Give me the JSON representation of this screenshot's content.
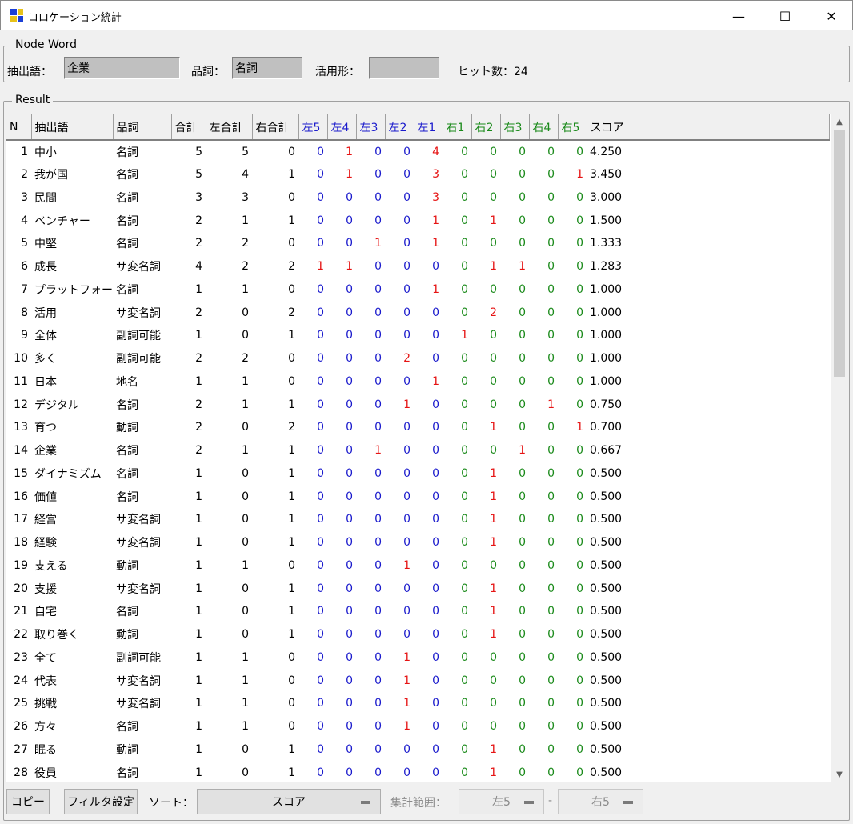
{
  "window": {
    "title": "コロケーション統計",
    "minimize_label": "—",
    "maximize_label": "☐",
    "close_label": "✕"
  },
  "node_word": {
    "legend": "Node Word",
    "extract_label": "抽出語：",
    "extract_value": "企業",
    "pos_label": "品詞：",
    "pos_value": "名詞",
    "conj_label": "活用形：",
    "conj_value": "",
    "hits_label": "ヒット数：24"
  },
  "result": {
    "legend": "Result",
    "columns": [
      "N",
      "抽出語",
      "品詞",
      "合計",
      "左合計",
      "右合計",
      "左5",
      "左4",
      "左3",
      "左2",
      "左1",
      "右1",
      "右2",
      "右3",
      "右4",
      "右5",
      "スコア"
    ],
    "rows": [
      [
        "1",
        "中小",
        "名詞",
        "5",
        "5",
        "0",
        "0",
        "1",
        "0",
        "0",
        "4",
        "0",
        "0",
        "0",
        "0",
        "0",
        "4.250"
      ],
      [
        "2",
        "我が国",
        "名詞",
        "5",
        "4",
        "1",
        "0",
        "1",
        "0",
        "0",
        "3",
        "0",
        "0",
        "0",
        "0",
        "1",
        "3.450"
      ],
      [
        "3",
        "民間",
        "名詞",
        "3",
        "3",
        "0",
        "0",
        "0",
        "0",
        "0",
        "3",
        "0",
        "0",
        "0",
        "0",
        "0",
        "3.000"
      ],
      [
        "4",
        "ベンチャー",
        "名詞",
        "2",
        "1",
        "1",
        "0",
        "0",
        "0",
        "0",
        "1",
        "0",
        "1",
        "0",
        "0",
        "0",
        "1.500"
      ],
      [
        "5",
        "中堅",
        "名詞",
        "2",
        "2",
        "0",
        "0",
        "0",
        "1",
        "0",
        "1",
        "0",
        "0",
        "0",
        "0",
        "0",
        "1.333"
      ],
      [
        "6",
        "成長",
        "サ変名詞",
        "4",
        "2",
        "2",
        "1",
        "1",
        "0",
        "0",
        "0",
        "0",
        "1",
        "1",
        "0",
        "0",
        "1.283"
      ],
      [
        "7",
        "プラットフォーム",
        "名詞",
        "1",
        "1",
        "0",
        "0",
        "0",
        "0",
        "0",
        "1",
        "0",
        "0",
        "0",
        "0",
        "0",
        "1.000"
      ],
      [
        "8",
        "活用",
        "サ変名詞",
        "2",
        "0",
        "2",
        "0",
        "0",
        "0",
        "0",
        "0",
        "0",
        "2",
        "0",
        "0",
        "0",
        "1.000"
      ],
      [
        "9",
        "全体",
        "副詞可能",
        "1",
        "0",
        "1",
        "0",
        "0",
        "0",
        "0",
        "0",
        "1",
        "0",
        "0",
        "0",
        "0",
        "1.000"
      ],
      [
        "10",
        "多く",
        "副詞可能",
        "2",
        "2",
        "0",
        "0",
        "0",
        "0",
        "2",
        "0",
        "0",
        "0",
        "0",
        "0",
        "0",
        "1.000"
      ],
      [
        "11",
        "日本",
        "地名",
        "1",
        "1",
        "0",
        "0",
        "0",
        "0",
        "0",
        "1",
        "0",
        "0",
        "0",
        "0",
        "0",
        "1.000"
      ],
      [
        "12",
        "デジタル",
        "名詞",
        "2",
        "1",
        "1",
        "0",
        "0",
        "0",
        "1",
        "0",
        "0",
        "0",
        "0",
        "1",
        "0",
        "0.750"
      ],
      [
        "13",
        "育つ",
        "動詞",
        "2",
        "0",
        "2",
        "0",
        "0",
        "0",
        "0",
        "0",
        "0",
        "1",
        "0",
        "0",
        "1",
        "0.700"
      ],
      [
        "14",
        "企業",
        "名詞",
        "2",
        "1",
        "1",
        "0",
        "0",
        "1",
        "0",
        "0",
        "0",
        "0",
        "1",
        "0",
        "0",
        "0.667"
      ],
      [
        "15",
        "ダイナミズム",
        "名詞",
        "1",
        "0",
        "1",
        "0",
        "0",
        "0",
        "0",
        "0",
        "0",
        "1",
        "0",
        "0",
        "0",
        "0.500"
      ],
      [
        "16",
        "価値",
        "名詞",
        "1",
        "0",
        "1",
        "0",
        "0",
        "0",
        "0",
        "0",
        "0",
        "1",
        "0",
        "0",
        "0",
        "0.500"
      ],
      [
        "17",
        "経営",
        "サ変名詞",
        "1",
        "0",
        "1",
        "0",
        "0",
        "0",
        "0",
        "0",
        "0",
        "1",
        "0",
        "0",
        "0",
        "0.500"
      ],
      [
        "18",
        "経験",
        "サ変名詞",
        "1",
        "0",
        "1",
        "0",
        "0",
        "0",
        "0",
        "0",
        "0",
        "1",
        "0",
        "0",
        "0",
        "0.500"
      ],
      [
        "19",
        "支える",
        "動詞",
        "1",
        "1",
        "0",
        "0",
        "0",
        "0",
        "1",
        "0",
        "0",
        "0",
        "0",
        "0",
        "0",
        "0.500"
      ],
      [
        "20",
        "支援",
        "サ変名詞",
        "1",
        "0",
        "1",
        "0",
        "0",
        "0",
        "0",
        "0",
        "0",
        "1",
        "0",
        "0",
        "0",
        "0.500"
      ],
      [
        "21",
        "自宅",
        "名詞",
        "1",
        "0",
        "1",
        "0",
        "0",
        "0",
        "0",
        "0",
        "0",
        "1",
        "0",
        "0",
        "0",
        "0.500"
      ],
      [
        "22",
        "取り巻く",
        "動詞",
        "1",
        "0",
        "1",
        "0",
        "0",
        "0",
        "0",
        "0",
        "0",
        "1",
        "0",
        "0",
        "0",
        "0.500"
      ],
      [
        "23",
        "全て",
        "副詞可能",
        "1",
        "1",
        "0",
        "0",
        "0",
        "0",
        "1",
        "0",
        "0",
        "0",
        "0",
        "0",
        "0",
        "0.500"
      ],
      [
        "24",
        "代表",
        "サ変名詞",
        "1",
        "1",
        "0",
        "0",
        "0",
        "0",
        "1",
        "0",
        "0",
        "0",
        "0",
        "0",
        "0",
        "0.500"
      ],
      [
        "25",
        "挑戦",
        "サ変名詞",
        "1",
        "1",
        "0",
        "0",
        "0",
        "0",
        "1",
        "0",
        "0",
        "0",
        "0",
        "0",
        "0",
        "0.500"
      ],
      [
        "26",
        "方々",
        "名詞",
        "1",
        "1",
        "0",
        "0",
        "0",
        "0",
        "1",
        "0",
        "0",
        "0",
        "0",
        "0",
        "0",
        "0.500"
      ],
      [
        "27",
        "眠る",
        "動詞",
        "1",
        "0",
        "1",
        "0",
        "0",
        "0",
        "0",
        "0",
        "0",
        "1",
        "0",
        "0",
        "0",
        "0.500"
      ],
      [
        "28",
        "役員",
        "名詞",
        "1",
        "0",
        "1",
        "0",
        "0",
        "0",
        "0",
        "0",
        "0",
        "1",
        "0",
        "0",
        "0",
        "0.500"
      ]
    ]
  },
  "toolbar": {
    "copy_label": "コピー",
    "filter_label": "フィルタ設定",
    "sort_label": "ソート：",
    "sort_value": "スコア",
    "range_label": "集計範囲：",
    "range_left_value": "左5",
    "range_sep": "-",
    "range_right_value": "右5"
  },
  "colors": {
    "left_header": "#1a1acc",
    "right_header": "#1a8a1a",
    "left_value": "#1a1acc",
    "left_nonzero": "#e61414",
    "right_value": "#1a8a1a",
    "right_nonzero": "#e61414"
  }
}
